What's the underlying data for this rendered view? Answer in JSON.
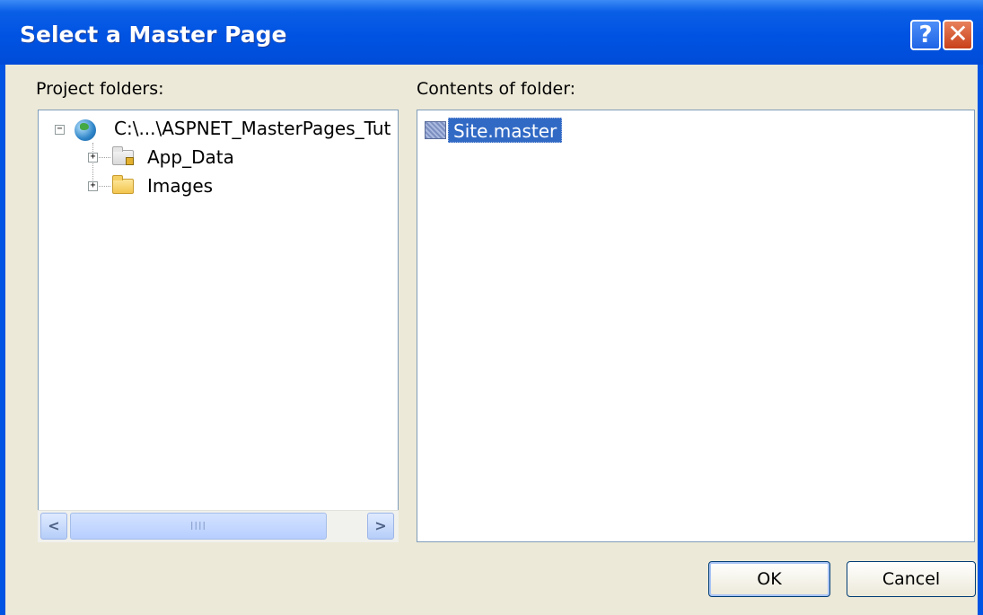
{
  "window": {
    "title": "Select a Master Page",
    "help_label": "?",
    "close_label": "✕"
  },
  "labels": {
    "project_folders": "Project folders:",
    "contents_of_folder": "Contents of folder:"
  },
  "tree": {
    "root": {
      "label": "C:\\...\\ASPNET_MasterPages_Tut",
      "expander": "−",
      "icon": "web-project-icon"
    },
    "children": [
      {
        "label": "App_Data",
        "expander": "+",
        "icon": "folder-locked-icon"
      },
      {
        "label": "Images",
        "expander": "+",
        "icon": "folder-icon"
      }
    ]
  },
  "scrollbar": {
    "left_arrow": "<",
    "right_arrow": ">",
    "thumb_grip": "IIII"
  },
  "contents": {
    "items": [
      {
        "label": "Site.master",
        "icon": "master-page-file-icon",
        "selected": true
      }
    ]
  },
  "buttons": {
    "ok": "OK",
    "cancel": "Cancel"
  },
  "colors": {
    "titlebar": "#0053e2",
    "dialog_bg": "#ece9d8",
    "selection": "#316ac5",
    "close_button": "#c8401a"
  }
}
